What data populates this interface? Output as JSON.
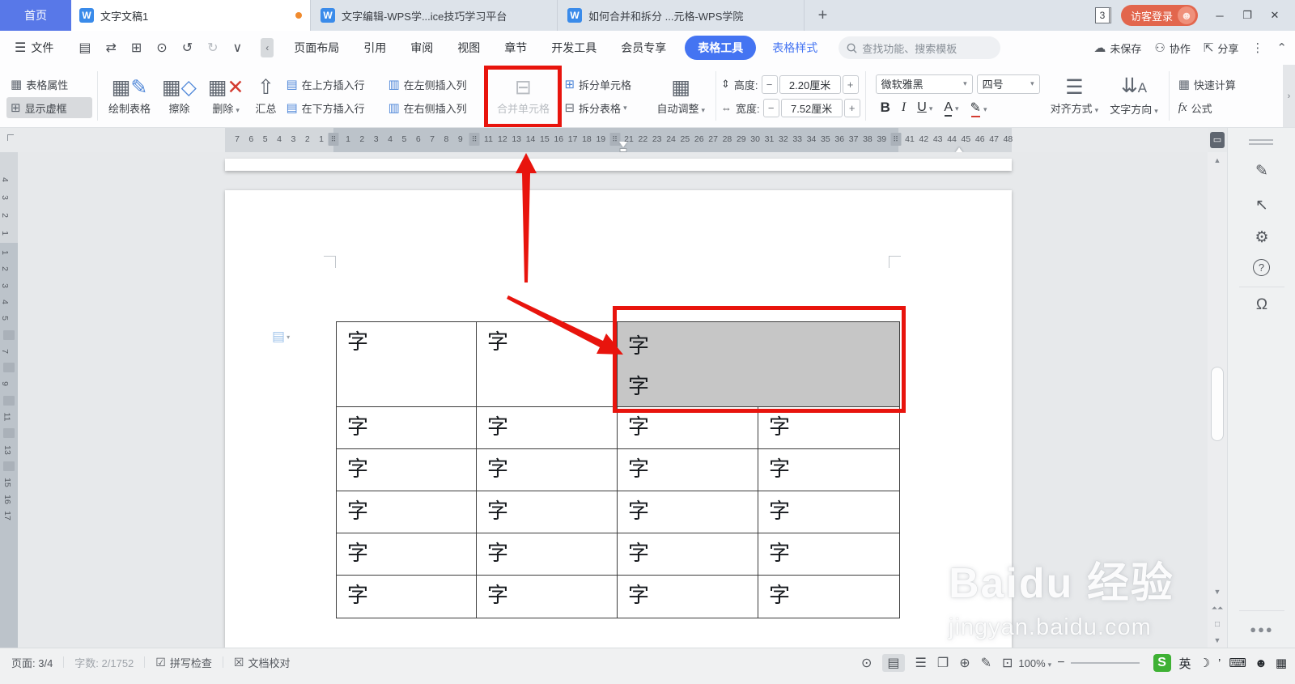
{
  "tabbar": {
    "home_tab": "首页",
    "doc_tab": {
      "label": "文字文稿1"
    },
    "web_tabs": [
      {
        "label": "文字编辑-WPS学...ice技巧学习平台"
      },
      {
        "label": "如何合并和拆分 ...元格-WPS学院"
      }
    ],
    "new_tab": "+",
    "window_count": "3",
    "login_button": "访客登录",
    "window_controls": {
      "minimize": "─",
      "restore": "❐",
      "close": "✕"
    }
  },
  "menubar": {
    "file_menu": "文件",
    "quick_icons": [
      {
        "name": "save-icon",
        "glyph": "▤"
      },
      {
        "name": "export-icon",
        "glyph": "⇄"
      },
      {
        "name": "print-icon",
        "glyph": "⊞"
      },
      {
        "name": "print-preview-icon",
        "glyph": "⊙"
      },
      {
        "name": "undo-icon",
        "glyph": "↺"
      },
      {
        "name": "redo-icon",
        "glyph": "↻"
      },
      {
        "name": "more-commands-icon",
        "glyph": "∨"
      }
    ],
    "collapse": "‹",
    "tabs": [
      "页面布局",
      "引用",
      "审阅",
      "视图",
      "章节",
      "开发工具",
      "会员专享"
    ],
    "active_tool_tab": "表格工具",
    "style_tab": "表格样式",
    "search_placeholder": "查找功能、搜索模板",
    "save_status": "未保存",
    "collab": "协作",
    "share": "分享"
  },
  "toolbar": {
    "table_properties": "表格属性",
    "show_gridlines": "显示虚框",
    "draw_table": "绘制表格",
    "eraser": "擦除",
    "delete": "删除",
    "summarize": "汇总",
    "insert_row_above": "在上方插入行",
    "insert_row_below": "在下方插入行",
    "insert_col_left": "在左侧插入列",
    "insert_col_right": "在右侧插入列",
    "merge_cells": "合并单元格",
    "split_cells": "拆分单元格",
    "split_table": "拆分表格",
    "autofit": "自动调整",
    "height_label": "高度:",
    "height_value": "2.20厘米",
    "width_label": "宽度:",
    "width_value": "7.52厘米",
    "minus": "−",
    "plus": "+",
    "font_name": "微软雅黑",
    "font_size": "四号",
    "bold": "B",
    "italic": "I",
    "underline": "U",
    "font_color": "A",
    "highlight_icon": "✎",
    "align": "对齐方式",
    "text_direction": "文字方向",
    "quick_calc": "快速计算",
    "formula_fx": "fx",
    "formula": "公式"
  },
  "ruler": {
    "h_desc": [
      7,
      6,
      5,
      4,
      3,
      2,
      1
    ],
    "h_asc_end": 48,
    "h_marker_units": [
      10,
      20,
      40
    ],
    "v_desc": [
      4,
      3,
      2,
      1
    ],
    "v_asc_end": 17,
    "v_marker_units": [
      6,
      8,
      10,
      12,
      14
    ]
  },
  "document": {
    "table": {
      "rows": [
        [
          "字",
          "字",
          {
            "lines": [
              "字",
              "字"
            ],
            "selected": true,
            "span": 2
          }
        ],
        [
          "字",
          "字",
          "字",
          "字"
        ],
        [
          "字",
          "字",
          "字",
          "字"
        ],
        [
          "字",
          "字",
          "字",
          "字"
        ],
        [
          "字",
          "字",
          "字",
          "字"
        ],
        [
          "字",
          "字",
          "字",
          "字"
        ]
      ]
    }
  },
  "watermark": {
    "line1": "Baidu 经验",
    "line2": "jingyan.baidu.com"
  },
  "statusbar": {
    "page": "页面: 3/4",
    "words": "字数: 2/1752",
    "spellcheck": "拼写检查",
    "proofread": "文档校对",
    "zoom": "100%",
    "ime_lang": "英"
  }
}
